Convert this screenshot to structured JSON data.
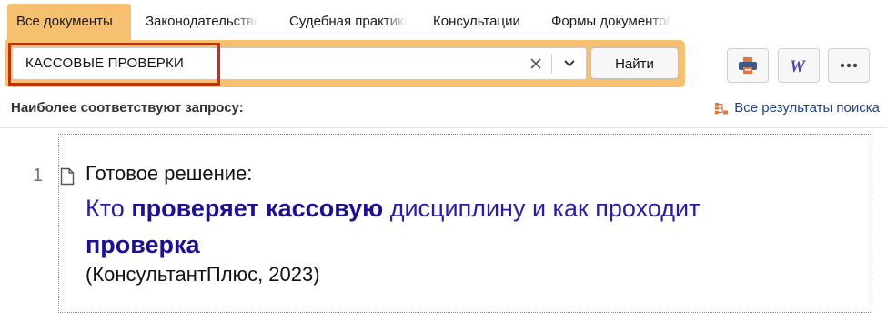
{
  "tabs": [
    {
      "label": "Все документы",
      "active": true
    },
    {
      "label": "Законодательство",
      "active": false
    },
    {
      "label": "Судебная практика",
      "active": false
    },
    {
      "label": "Консультации",
      "active": false
    },
    {
      "label": "Формы документов",
      "active": false
    }
  ],
  "search": {
    "query": "КАССОВЫЕ ПРОВЕРКИ",
    "find_label": "Найти"
  },
  "toolbar": {
    "icons": [
      "print-icon",
      "word-icon",
      "more-icon"
    ]
  },
  "results": {
    "heading": "Наиболее соответствуют запросу:",
    "all_results_label": "Все результаты поиска",
    "items": [
      {
        "number": "1",
        "type": "Готовое решение:",
        "title_parts": [
          {
            "text": "Кто ",
            "bold": false
          },
          {
            "text": "проверяет кассовую",
            "bold": true
          },
          {
            "text": " дисциплину и как проходит ",
            "bold": false
          },
          {
            "text": "проверка",
            "bold": true
          }
        ],
        "source": "(КонсультантПлюс, 2023)"
      }
    ]
  },
  "colors": {
    "accent": "#f6c070",
    "highlight": "#e0211b",
    "link": "#2a1ab0"
  }
}
